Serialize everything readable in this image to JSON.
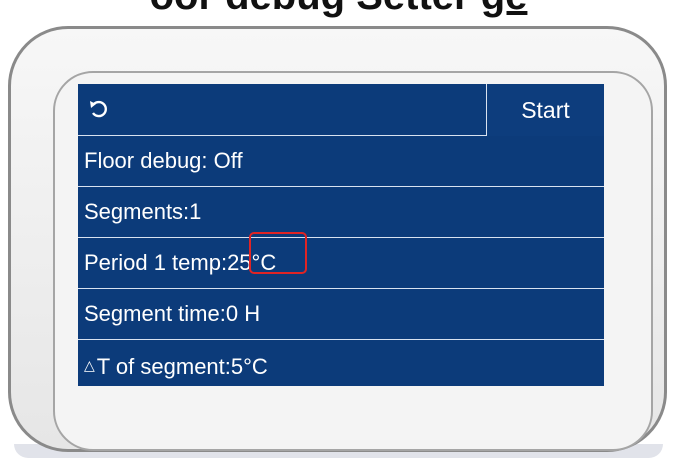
{
  "header": {
    "title_visible_tail": "oor debug  Setter",
    "title_underlined": "ge"
  },
  "screen": {
    "start_label": "Start",
    "rows": [
      {
        "label": "Floor debug: Off"
      },
      {
        "label": "Segments:1"
      },
      {
        "label": "Period 1 temp:25°C"
      },
      {
        "label": "Segment time:0 H"
      },
      {
        "delta_symbol": "△",
        "label": "T of segment:5°C"
      }
    ]
  },
  "colors": {
    "screen_bg": "#0c3b7a",
    "row_divider": "#d9e2f0",
    "highlight": "#e02424"
  },
  "icons": {
    "back": "back-arrow-icon"
  }
}
